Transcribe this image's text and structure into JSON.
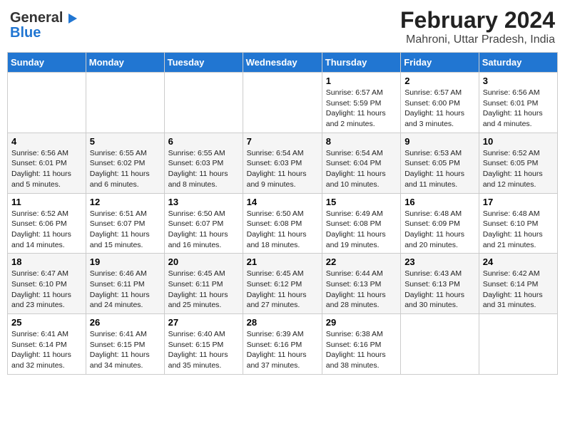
{
  "header": {
    "logo_general": "General",
    "logo_blue": "Blue",
    "month_title": "February 2024",
    "location": "Mahroni, Uttar Pradesh, India"
  },
  "columns": [
    "Sunday",
    "Monday",
    "Tuesday",
    "Wednesday",
    "Thursday",
    "Friday",
    "Saturday"
  ],
  "weeks": [
    [
      {
        "day": "",
        "info": ""
      },
      {
        "day": "",
        "info": ""
      },
      {
        "day": "",
        "info": ""
      },
      {
        "day": "",
        "info": ""
      },
      {
        "day": "1",
        "info": "Sunrise: 6:57 AM\nSunset: 5:59 PM\nDaylight: 11 hours and 2 minutes."
      },
      {
        "day": "2",
        "info": "Sunrise: 6:57 AM\nSunset: 6:00 PM\nDaylight: 11 hours and 3 minutes."
      },
      {
        "day": "3",
        "info": "Sunrise: 6:56 AM\nSunset: 6:01 PM\nDaylight: 11 hours and 4 minutes."
      }
    ],
    [
      {
        "day": "4",
        "info": "Sunrise: 6:56 AM\nSunset: 6:01 PM\nDaylight: 11 hours and 5 minutes."
      },
      {
        "day": "5",
        "info": "Sunrise: 6:55 AM\nSunset: 6:02 PM\nDaylight: 11 hours and 6 minutes."
      },
      {
        "day": "6",
        "info": "Sunrise: 6:55 AM\nSunset: 6:03 PM\nDaylight: 11 hours and 8 minutes."
      },
      {
        "day": "7",
        "info": "Sunrise: 6:54 AM\nSunset: 6:03 PM\nDaylight: 11 hours and 9 minutes."
      },
      {
        "day": "8",
        "info": "Sunrise: 6:54 AM\nSunset: 6:04 PM\nDaylight: 11 hours and 10 minutes."
      },
      {
        "day": "9",
        "info": "Sunrise: 6:53 AM\nSunset: 6:05 PM\nDaylight: 11 hours and 11 minutes."
      },
      {
        "day": "10",
        "info": "Sunrise: 6:52 AM\nSunset: 6:05 PM\nDaylight: 11 hours and 12 minutes."
      }
    ],
    [
      {
        "day": "11",
        "info": "Sunrise: 6:52 AM\nSunset: 6:06 PM\nDaylight: 11 hours and 14 minutes."
      },
      {
        "day": "12",
        "info": "Sunrise: 6:51 AM\nSunset: 6:07 PM\nDaylight: 11 hours and 15 minutes."
      },
      {
        "day": "13",
        "info": "Sunrise: 6:50 AM\nSunset: 6:07 PM\nDaylight: 11 hours and 16 minutes."
      },
      {
        "day": "14",
        "info": "Sunrise: 6:50 AM\nSunset: 6:08 PM\nDaylight: 11 hours and 18 minutes."
      },
      {
        "day": "15",
        "info": "Sunrise: 6:49 AM\nSunset: 6:08 PM\nDaylight: 11 hours and 19 minutes."
      },
      {
        "day": "16",
        "info": "Sunrise: 6:48 AM\nSunset: 6:09 PM\nDaylight: 11 hours and 20 minutes."
      },
      {
        "day": "17",
        "info": "Sunrise: 6:48 AM\nSunset: 6:10 PM\nDaylight: 11 hours and 21 minutes."
      }
    ],
    [
      {
        "day": "18",
        "info": "Sunrise: 6:47 AM\nSunset: 6:10 PM\nDaylight: 11 hours and 23 minutes."
      },
      {
        "day": "19",
        "info": "Sunrise: 6:46 AM\nSunset: 6:11 PM\nDaylight: 11 hours and 24 minutes."
      },
      {
        "day": "20",
        "info": "Sunrise: 6:45 AM\nSunset: 6:11 PM\nDaylight: 11 hours and 25 minutes."
      },
      {
        "day": "21",
        "info": "Sunrise: 6:45 AM\nSunset: 6:12 PM\nDaylight: 11 hours and 27 minutes."
      },
      {
        "day": "22",
        "info": "Sunrise: 6:44 AM\nSunset: 6:13 PM\nDaylight: 11 hours and 28 minutes."
      },
      {
        "day": "23",
        "info": "Sunrise: 6:43 AM\nSunset: 6:13 PM\nDaylight: 11 hours and 30 minutes."
      },
      {
        "day": "24",
        "info": "Sunrise: 6:42 AM\nSunset: 6:14 PM\nDaylight: 11 hours and 31 minutes."
      }
    ],
    [
      {
        "day": "25",
        "info": "Sunrise: 6:41 AM\nSunset: 6:14 PM\nDaylight: 11 hours and 32 minutes."
      },
      {
        "day": "26",
        "info": "Sunrise: 6:41 AM\nSunset: 6:15 PM\nDaylight: 11 hours and 34 minutes."
      },
      {
        "day": "27",
        "info": "Sunrise: 6:40 AM\nSunset: 6:15 PM\nDaylight: 11 hours and 35 minutes."
      },
      {
        "day": "28",
        "info": "Sunrise: 6:39 AM\nSunset: 6:16 PM\nDaylight: 11 hours and 37 minutes."
      },
      {
        "day": "29",
        "info": "Sunrise: 6:38 AM\nSunset: 6:16 PM\nDaylight: 11 hours and 38 minutes."
      },
      {
        "day": "",
        "info": ""
      },
      {
        "day": "",
        "info": ""
      }
    ]
  ]
}
